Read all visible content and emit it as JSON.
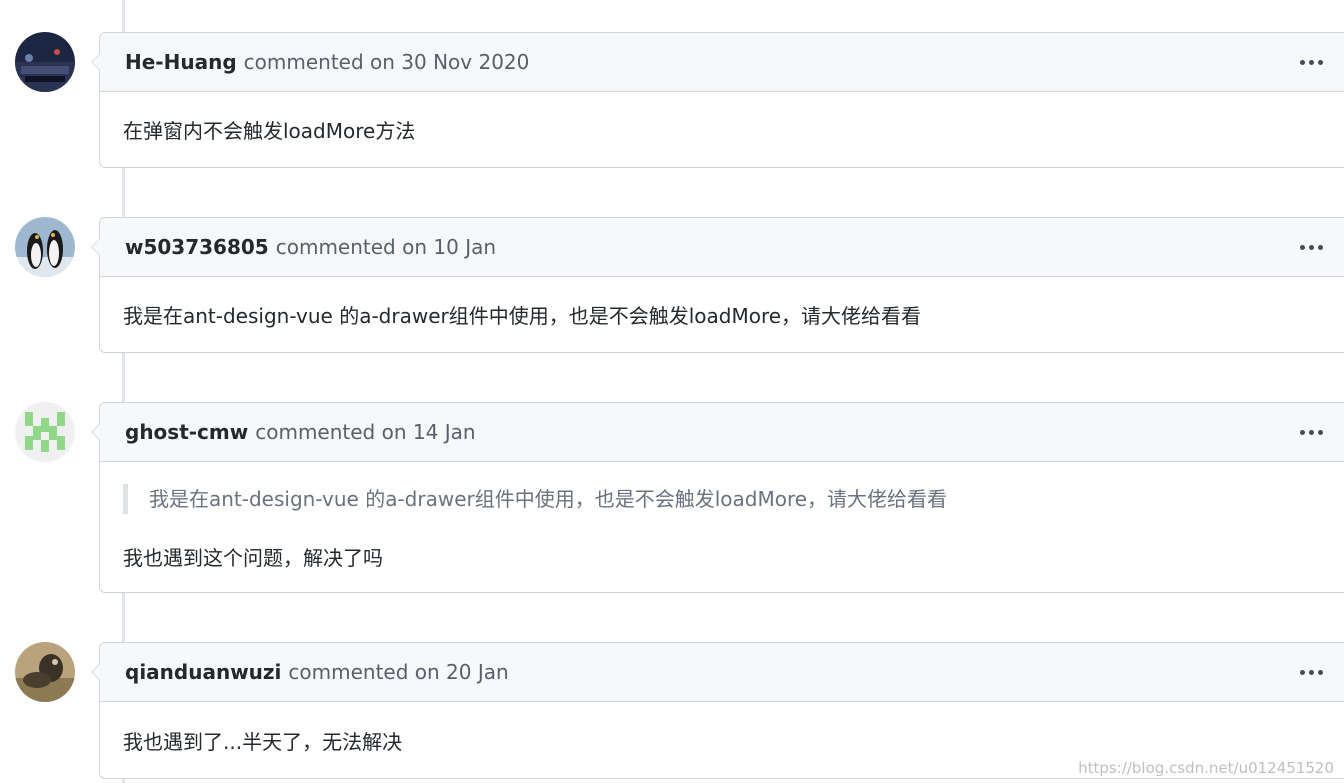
{
  "comments": [
    {
      "author": "He-Huang",
      "meta": "commented on 30 Nov 2020",
      "body": "在弹窗内不会触发loadMore方法",
      "avatar": "avatar-dark-landscape"
    },
    {
      "author": "w503736805",
      "meta": "commented on 10 Jan",
      "body": "我是在ant-design-vue 的a-drawer组件中使用，也是不会触发loadMore，请大佬给看看",
      "avatar": "avatar-penguins"
    },
    {
      "author": "ghost-cmw",
      "meta": "commented on 14 Jan",
      "quote": "我是在ant-design-vue 的a-drawer组件中使用，也是不会触发loadMore，请大佬给看看",
      "body": "我也遇到这个问题，解决了吗",
      "avatar": "avatar-identicon-green"
    },
    {
      "author": "qianduanwuzi",
      "meta": "commented on 20 Jan",
      "body": "我也遇到了...半天了，无法解决",
      "avatar": "avatar-animal-photo"
    }
  ],
  "watermark": "https://blog.csdn.net/u012451520",
  "colors": {
    "header_bg": "#f6f8fa",
    "border": "#d1d5da",
    "text": "#24292e",
    "muted": "#586069",
    "identicon": "#8fd88a"
  }
}
